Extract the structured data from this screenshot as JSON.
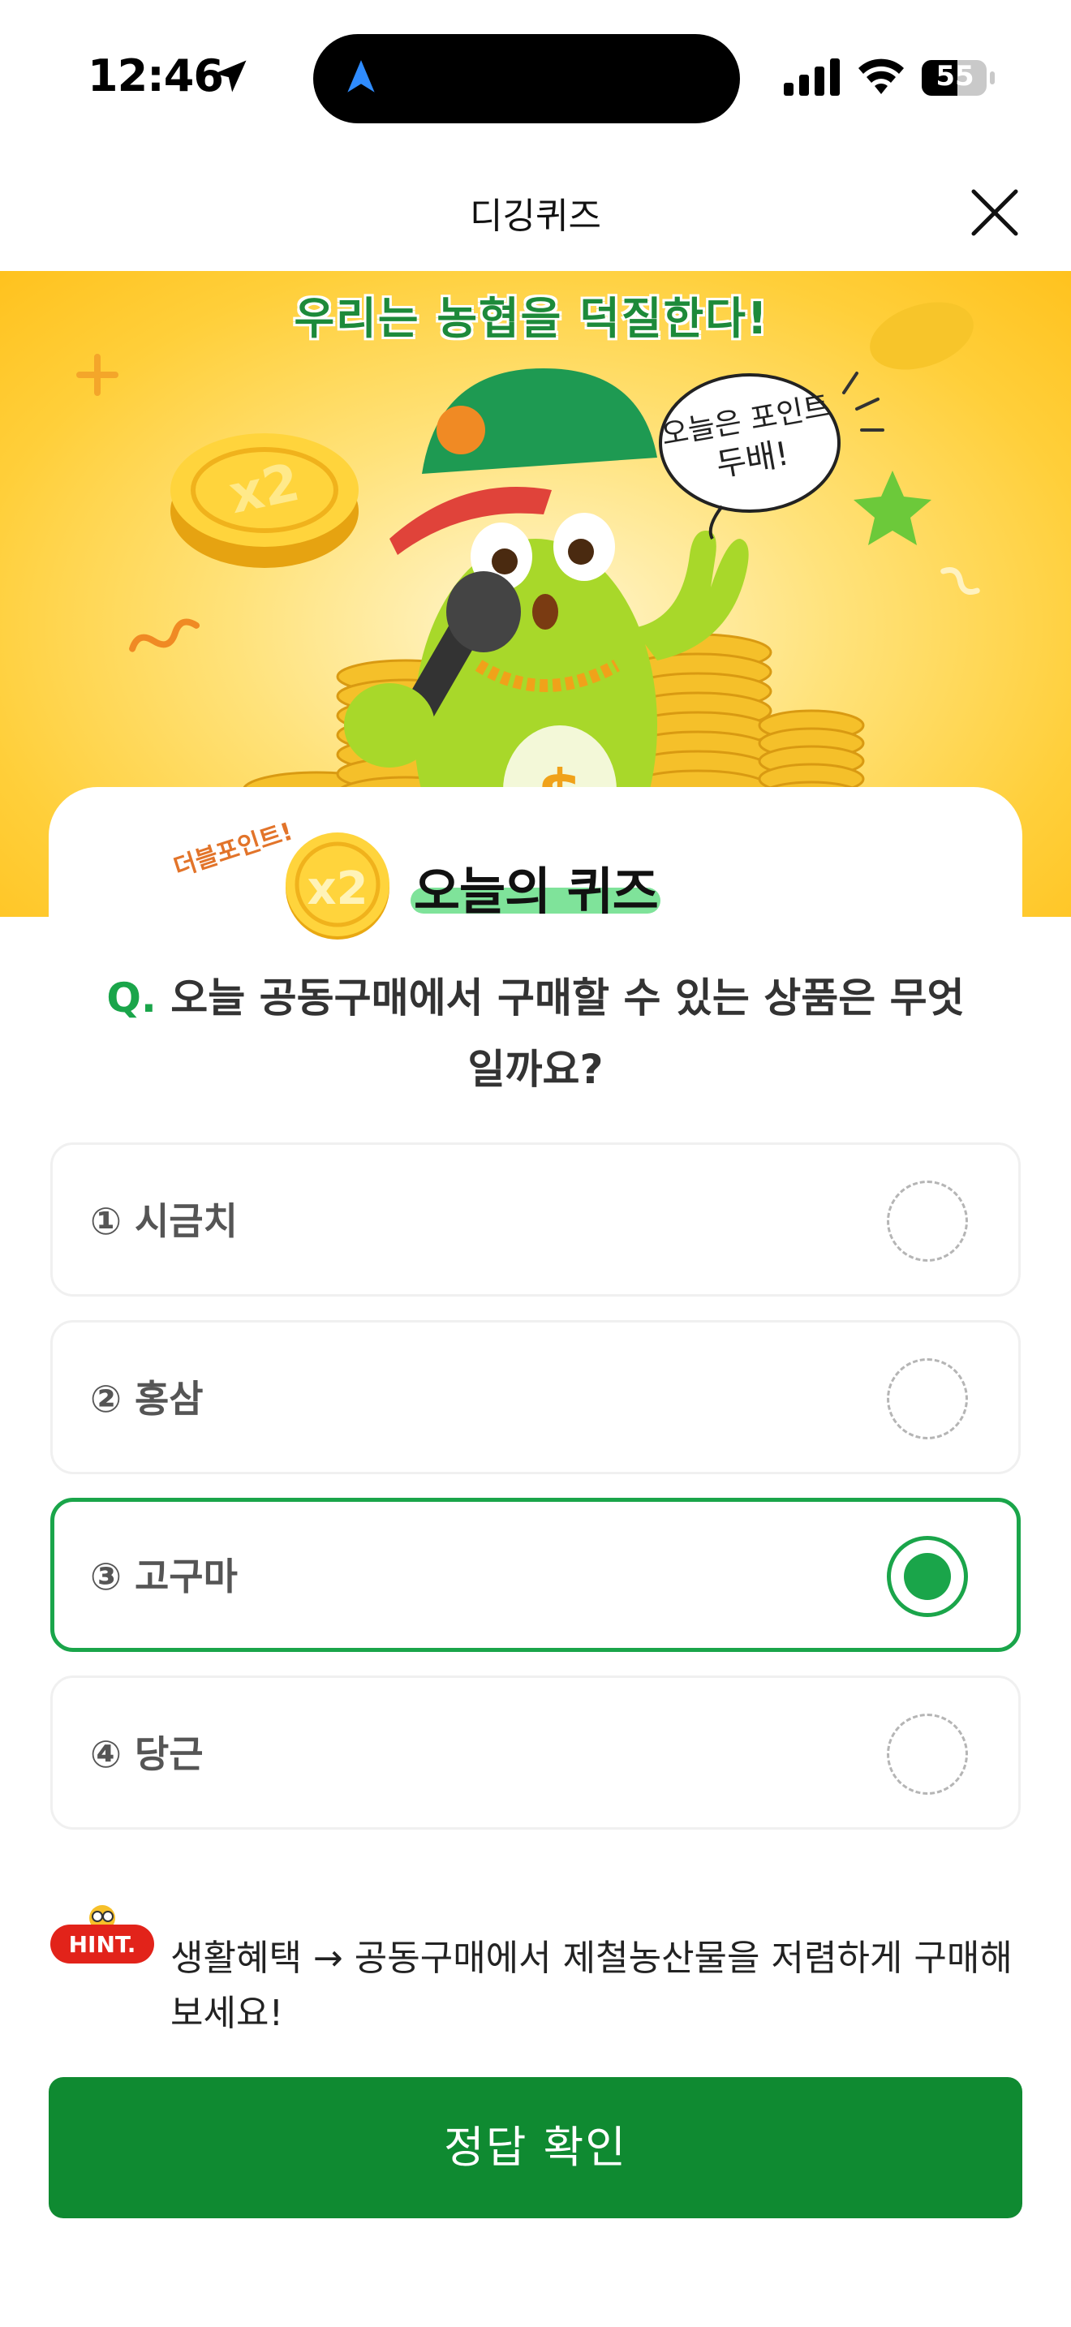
{
  "status_bar": {
    "time": "12:46",
    "battery": "55"
  },
  "header": {
    "title": "디깅퀴즈"
  },
  "banner": {
    "headline": "우리는 농협을 덕질한다!",
    "speech": "오늘은 포인트 두배!"
  },
  "quiz": {
    "double_label": "더블포인트!",
    "coin_label": "x2",
    "title": "오늘의 퀴즈",
    "question_prefix": "Q.",
    "question": "오늘 공동구매에서 구매할 수 있는 상품은 무엇일까요?",
    "options": [
      {
        "label": "① 시금치",
        "selected": false
      },
      {
        "label": "② 홍삼",
        "selected": false
      },
      {
        "label": "③ 고구마",
        "selected": true
      },
      {
        "label": "④ 당근",
        "selected": false
      }
    ]
  },
  "hint": {
    "badge": "HINT.",
    "text": "생활혜택 → 공동구매에서 제철농산물을 저렴하게 구매해 보세요!"
  },
  "confirm": {
    "label": "정답 확인"
  },
  "colors": {
    "accent": "#1aa54a",
    "button": "#0f8a31",
    "banner": "#ffcf3a",
    "hint_red": "#e2231a"
  }
}
